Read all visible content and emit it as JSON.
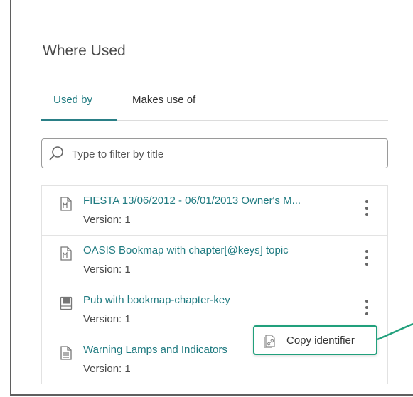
{
  "panel": {
    "title": "Where Used"
  },
  "tabs": [
    {
      "label": "Used by",
      "active": true
    },
    {
      "label": "Makes use of",
      "active": false
    }
  ],
  "search": {
    "placeholder": "Type to filter by title",
    "value": ""
  },
  "items": [
    {
      "title": "FIESTA 13/06/2012 - 06/01/2013 Owner's M...",
      "version": "Version: 1",
      "icon": "bookmap-icon"
    },
    {
      "title": "OASIS Bookmap with chapter[@keys] topic",
      "version": "Version: 1",
      "icon": "bookmap-icon"
    },
    {
      "title": "Pub with bookmap-chapter-key",
      "version": "Version: 1",
      "icon": "publication-icon"
    },
    {
      "title": "Warning Lamps and Indicators",
      "version": "Version: 1",
      "icon": "topic-icon"
    }
  ],
  "context_menu": {
    "label": "Copy identifier",
    "icon": "copy-link-icon"
  },
  "colors": {
    "accent": "#1f7a80",
    "highlight": "#21a07c"
  }
}
